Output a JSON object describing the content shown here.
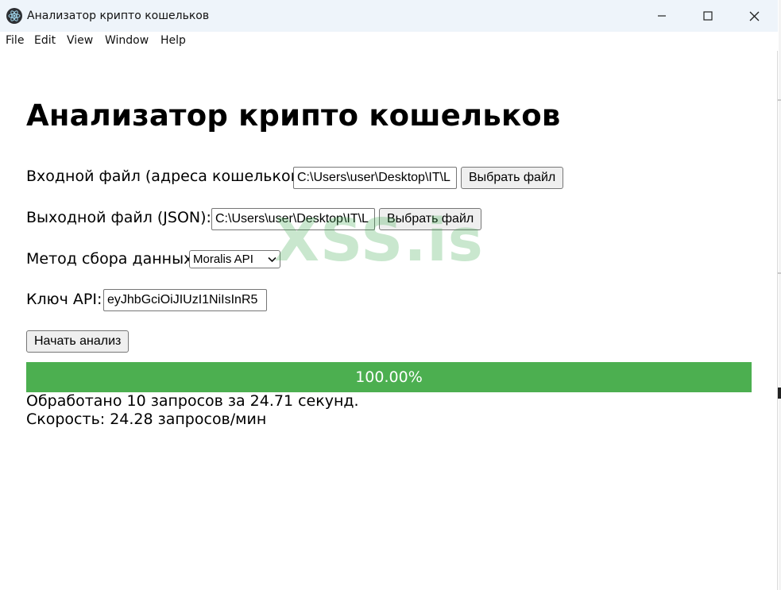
{
  "window": {
    "title": "Анализатор крипто кошельков",
    "controls": {
      "minimize": "minimize-icon",
      "maximize": "maximize-icon",
      "close": "close-icon"
    }
  },
  "menu": {
    "items": [
      "File",
      "Edit",
      "View",
      "Window",
      "Help"
    ]
  },
  "main": {
    "heading": "Анализатор крипто кошельков",
    "input_file": {
      "label": "Входной файл (адреса кошельков):",
      "value": "C:\\Users\\user\\Desktop\\IT\\L",
      "button": "Выбрать файл"
    },
    "output_file": {
      "label": "Выходной файл (JSON):",
      "value": "C:\\Users\\user\\Desktop\\IT\\L",
      "button": "Выбрать файл"
    },
    "method": {
      "label": "Метод сбора данных:",
      "selected": "Moralis API"
    },
    "api_key": {
      "label": "Ключ API:",
      "value": "eyJhbGciOiJIUzI1NiIsInR5"
    },
    "start_button": "Начать анализ",
    "progress": {
      "value": 1.0,
      "label": "100.00%",
      "color": "#4caf50"
    },
    "stats": {
      "processed": "Обработано 10 запросов за 24.71 секунд.",
      "speed": "Скорость: 24.28 запросов/мин"
    }
  },
  "watermark": "XSS.is"
}
